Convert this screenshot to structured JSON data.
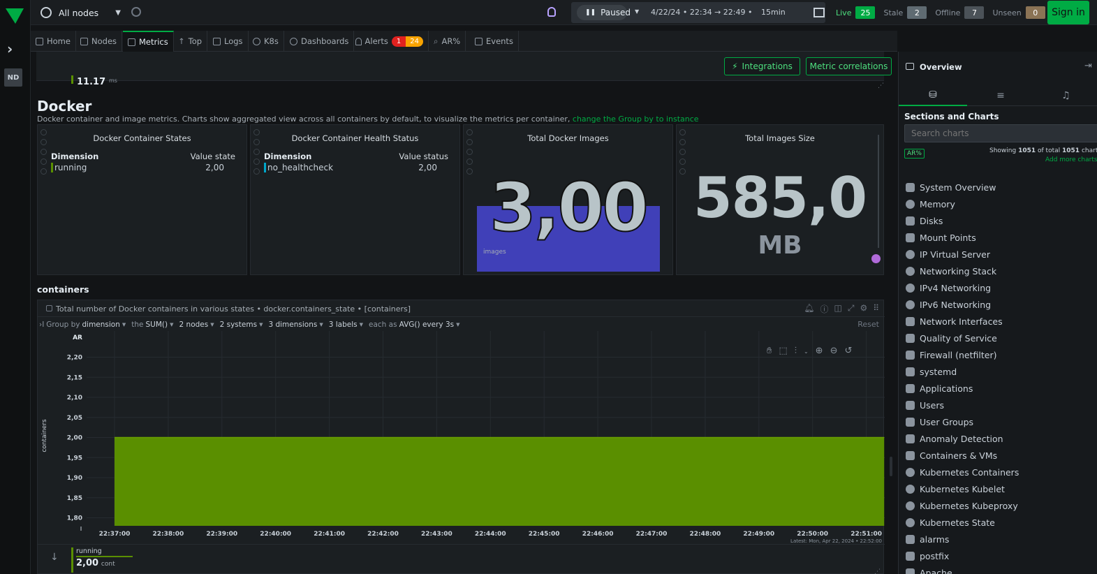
{
  "left_rail": {
    "avatar_initials": "ND"
  },
  "topbar": {
    "node_selector": "All nodes",
    "paused_label": "Paused",
    "time_range": "4/22/24 • 22:34 → 22:49 •",
    "duration": "15min",
    "live_label": "Live",
    "live_count": "25",
    "stale_label": "Stale",
    "stale_count": "2",
    "offline_label": "Offline",
    "offline_count": "7",
    "unseen_label": "Unseen",
    "unseen_count": "0",
    "sign_in": "Sign in"
  },
  "nav": {
    "tabs": [
      {
        "label": "Home",
        "icon": "home-icon"
      },
      {
        "label": "Nodes",
        "icon": "nodes-icon"
      },
      {
        "label": "Metrics",
        "icon": "metrics-icon"
      },
      {
        "label": "Top",
        "icon": "top-icon"
      },
      {
        "label": "Logs",
        "icon": "logs-icon"
      },
      {
        "label": "K8s",
        "icon": "k8s-icon"
      },
      {
        "label": "Dashboards",
        "icon": "dashboards-icon"
      },
      {
        "label": "Alerts",
        "icon": "alerts-icon"
      },
      {
        "label": "AR%",
        "icon": "ar-icon"
      },
      {
        "label": "Events",
        "icon": "events-icon"
      }
    ],
    "alerts_critical": "1",
    "alerts_warning": "24"
  },
  "toolbar": {
    "integrations": "Integrations",
    "metric_correlations": "Metric correlations"
  },
  "prev_value": "11.17",
  "prev_unit": "ms",
  "section": {
    "title": "Docker",
    "description": "Docker container and image metrics. Charts show aggregated view across all containers by default, to visualize the metrics per container,",
    "description_link": "change the Group by to instance"
  },
  "cards": {
    "states": {
      "title": "Docker Container States",
      "dim_header": "Dimension",
      "value_header": "Value state",
      "dim": "running",
      "value": "2,00"
    },
    "health": {
      "title": "Docker Container Health Status",
      "dim_header": "Dimension",
      "value_header": "Value status",
      "dim": "no_healthcheck",
      "value": "2,00"
    },
    "images": {
      "title": "Total Docker Images",
      "value": "3,00",
      "unit": "images",
      "fill_fraction": 0.75
    },
    "size": {
      "title": "Total Images Size",
      "value": "585,0",
      "unit": "MB"
    }
  },
  "subsection": "containers",
  "chart_header": {
    "title": "Total number of Docker containers in various states • docker.containers_state • [containers]",
    "group_by_prefix": "Group by",
    "group_by": "dimension",
    "the": "the",
    "agg": "SUM()",
    "nodes": "2 nodes",
    "systems": "2 systems",
    "dimensions": "3 dimensions",
    "labels": "3 labels",
    "each_as": "each as",
    "time_agg": "AVG() every 3s",
    "reset": "Reset"
  },
  "chart_data": {
    "type": "area",
    "ylabel": "containers",
    "ylim": [
      1.78,
      2.22
    ],
    "yticks": [
      "2,20",
      "2,15",
      "2,10",
      "2,05",
      "2,00",
      "1,95",
      "1,90",
      "1,85",
      "1,80"
    ],
    "ytick_values": [
      2.2,
      2.15,
      2.1,
      2.05,
      2.0,
      1.95,
      1.9,
      1.85,
      1.8
    ],
    "xticks": [
      "22:37:00",
      "22:38:00",
      "22:39:00",
      "22:40:00",
      "22:41:00",
      "22:42:00",
      "22:43:00",
      "22:44:00",
      "22:45:00",
      "22:46:00",
      "22:47:00",
      "22:48:00",
      "22:49:00",
      "22:50:00",
      "22:51:00"
    ],
    "series": [
      {
        "name": "running",
        "color": "#5a8f00",
        "start": "22:37:00",
        "end": "22:51:20",
        "value": 2.0
      }
    ],
    "ar_label": "AR",
    "latest": "Latest: Mon, Apr 22, 2024 • 22:52:00"
  },
  "legend": {
    "name": "running",
    "value": "2,00",
    "unit": "cont"
  },
  "side": {
    "title": "Overview",
    "sections_title": "Sections and Charts",
    "search_placeholder": "Search charts",
    "ar_badge": "AR%",
    "showing_prefix": "Showing",
    "showing_count": "1051",
    "showing_mid": "of total",
    "showing_total": "1051",
    "showing_suffix": "charts",
    "add_more": "Add more charts",
    "items": [
      {
        "label": "System Overview",
        "icon": "bookmark-icon"
      },
      {
        "label": "Memory",
        "icon": "memory-icon"
      },
      {
        "label": "Disks",
        "icon": "disk-icon"
      },
      {
        "label": "Mount Points",
        "icon": "mount-icon"
      },
      {
        "label": "IP Virtual Server",
        "icon": "cube-icon"
      },
      {
        "label": "Networking Stack",
        "icon": "cloud-icon"
      },
      {
        "label": "IPv4 Networking",
        "icon": "cloud-icon"
      },
      {
        "label": "IPv6 Networking",
        "icon": "cloud-icon"
      },
      {
        "label": "Network Interfaces",
        "icon": "network-icon"
      },
      {
        "label": "Quality of Service",
        "icon": "qos-icon"
      },
      {
        "label": "Firewall (netfilter)",
        "icon": "shield-icon"
      },
      {
        "label": "systemd",
        "icon": "dots-icon"
      },
      {
        "label": "Applications",
        "icon": "apps-icon"
      },
      {
        "label": "Users",
        "icon": "users-icon"
      },
      {
        "label": "User Groups",
        "icon": "user-icon"
      },
      {
        "label": "Anomaly Detection",
        "icon": "brain-icon"
      },
      {
        "label": "Containers & VMs",
        "icon": "container-icon"
      },
      {
        "label": "Kubernetes Containers",
        "icon": "k8s-icon"
      },
      {
        "label": "Kubernetes Kubelet",
        "icon": "k8s-icon"
      },
      {
        "label": "Kubernetes Kubeproxy",
        "icon": "k8s-icon"
      },
      {
        "label": "Kubernetes State",
        "icon": "k8s-icon"
      },
      {
        "label": "alarms",
        "icon": "puzzle-icon"
      },
      {
        "label": "postfix",
        "icon": "mail-icon"
      },
      {
        "label": "Apache",
        "icon": "feather-icon"
      }
    ]
  }
}
